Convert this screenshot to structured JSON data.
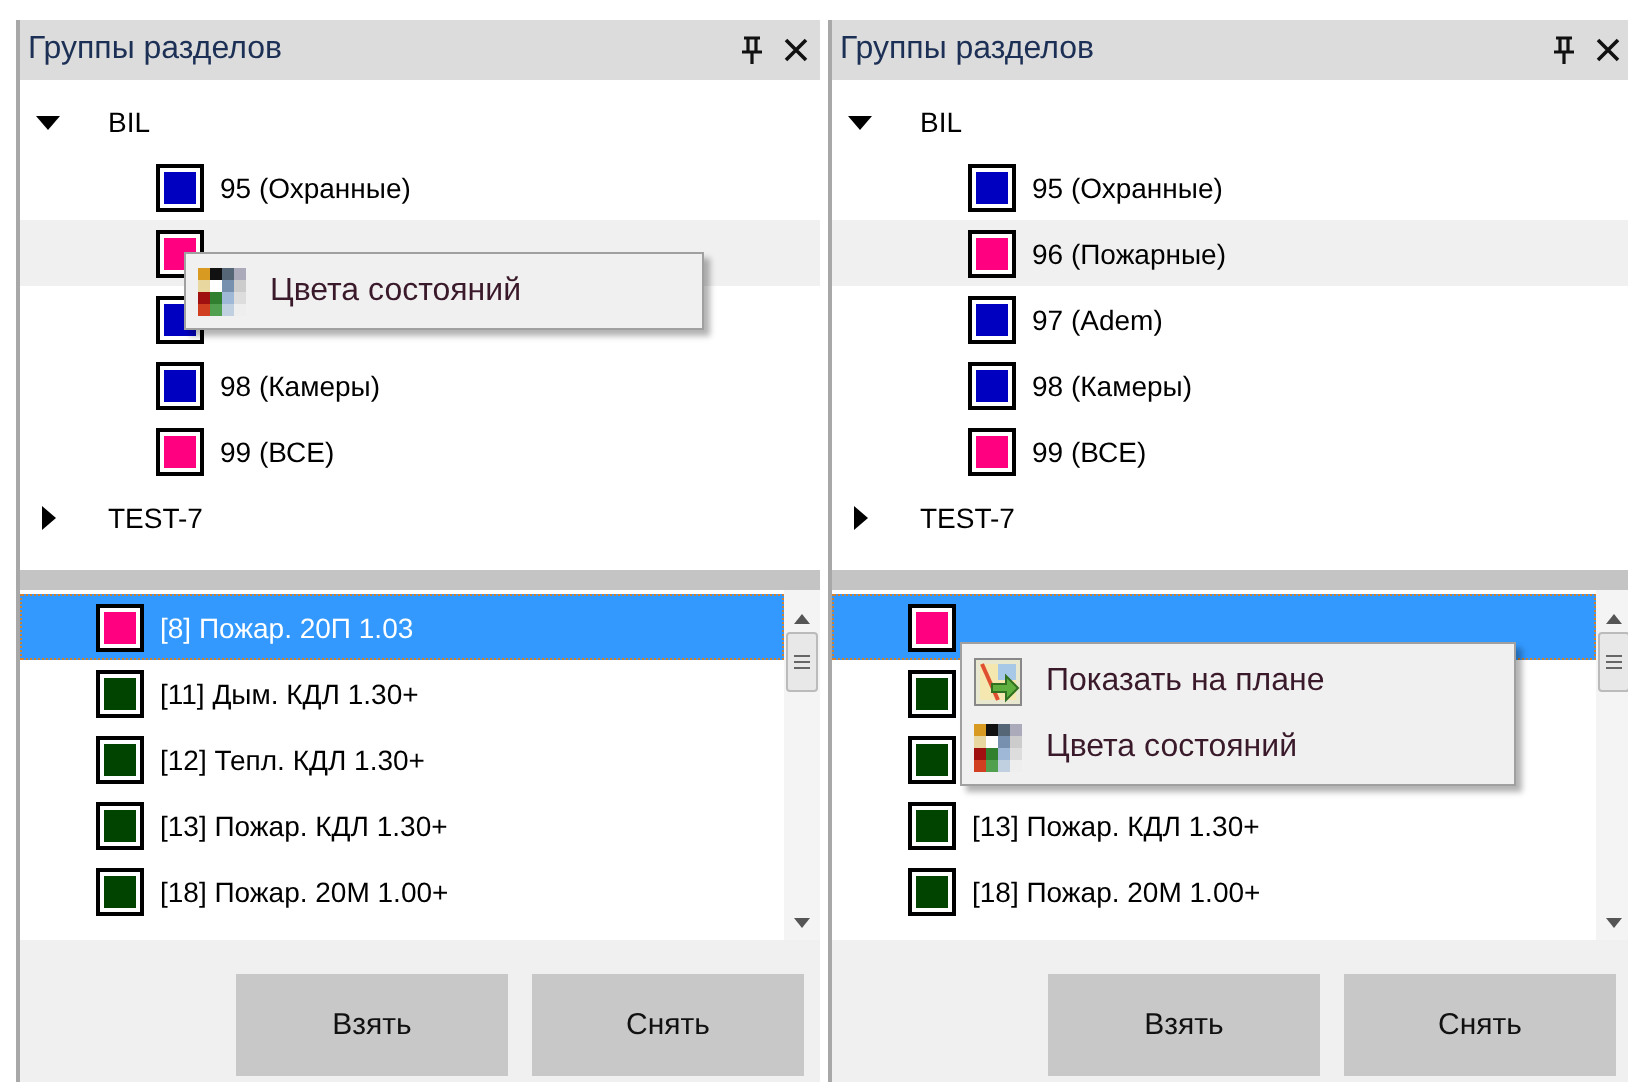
{
  "panels": [
    {
      "title": "Группы разделов",
      "tree": [
        {
          "label": "BIL",
          "expanded": true,
          "children": [
            {
              "label": "95 (Охранные)",
              "color": "#0000c0",
              "hovered": false
            },
            {
              "color": "#ff0080",
              "hovered": true,
              "context_menu": [
                {
                  "kind": "colors",
                  "label": "Цвета состояний"
                }
              ]
            },
            {
              "color": "#0000c0",
              "hovered": false
            },
            {
              "label": "98 (Камеры)",
              "color": "#0000c0",
              "hovered": false
            },
            {
              "label": "99 (ВСЕ)",
              "color": "#ff0080",
              "hovered": false
            }
          ]
        },
        {
          "label": "TEST-7",
          "expanded": false
        }
      ],
      "list": [
        {
          "label": "[8] Пожар. 20П 1.03",
          "color": "#ff0080",
          "selected": true
        },
        {
          "label": "[11] Дым. КДЛ 1.30+",
          "color": "#004400",
          "selected": false
        },
        {
          "label": "[12] Тепл. КДЛ 1.30+",
          "color": "#004400",
          "selected": false
        },
        {
          "label": "[13] Пожар. КДЛ 1.30+",
          "color": "#004400",
          "selected": false
        },
        {
          "label": "[18] Пожар. 20М 1.00+",
          "color": "#004400",
          "selected": false
        }
      ],
      "buttons": [
        "Взять",
        "Снять"
      ]
    },
    {
      "title": "Группы разделов",
      "tree": [
        {
          "label": "BIL",
          "expanded": true,
          "children": [
            {
              "label": "95 (Охранные)",
              "color": "#0000c0",
              "hovered": false
            },
            {
              "label": "96 (Пожарные)",
              "color": "#ff0080",
              "hovered": true
            },
            {
              "label": "97 (Adem)",
              "color": "#0000c0",
              "hovered": false
            },
            {
              "label": "98 (Камеры)",
              "color": "#0000c0",
              "hovered": false
            },
            {
              "label": "99 (ВСЕ)",
              "color": "#ff0080",
              "hovered": false
            }
          ]
        },
        {
          "label": "TEST-7",
          "expanded": false
        }
      ],
      "list": [
        {
          "color": "#ff0080",
          "selected": true,
          "context_menu": [
            {
              "kind": "map",
              "label": "Показать на плане"
            },
            {
              "kind": "colors",
              "label": "Цвета состояний"
            }
          ]
        },
        {
          "color": "#004400",
          "selected": false
        },
        {
          "color": "#004400",
          "selected": false
        },
        {
          "label": "[13] Пожар. КДЛ 1.30+",
          "color": "#004400",
          "selected": false
        },
        {
          "label": "[18] Пожар. 20М 1.00+",
          "color": "#004400",
          "selected": false
        }
      ],
      "buttons": [
        "Взять",
        "Снять"
      ]
    }
  ]
}
